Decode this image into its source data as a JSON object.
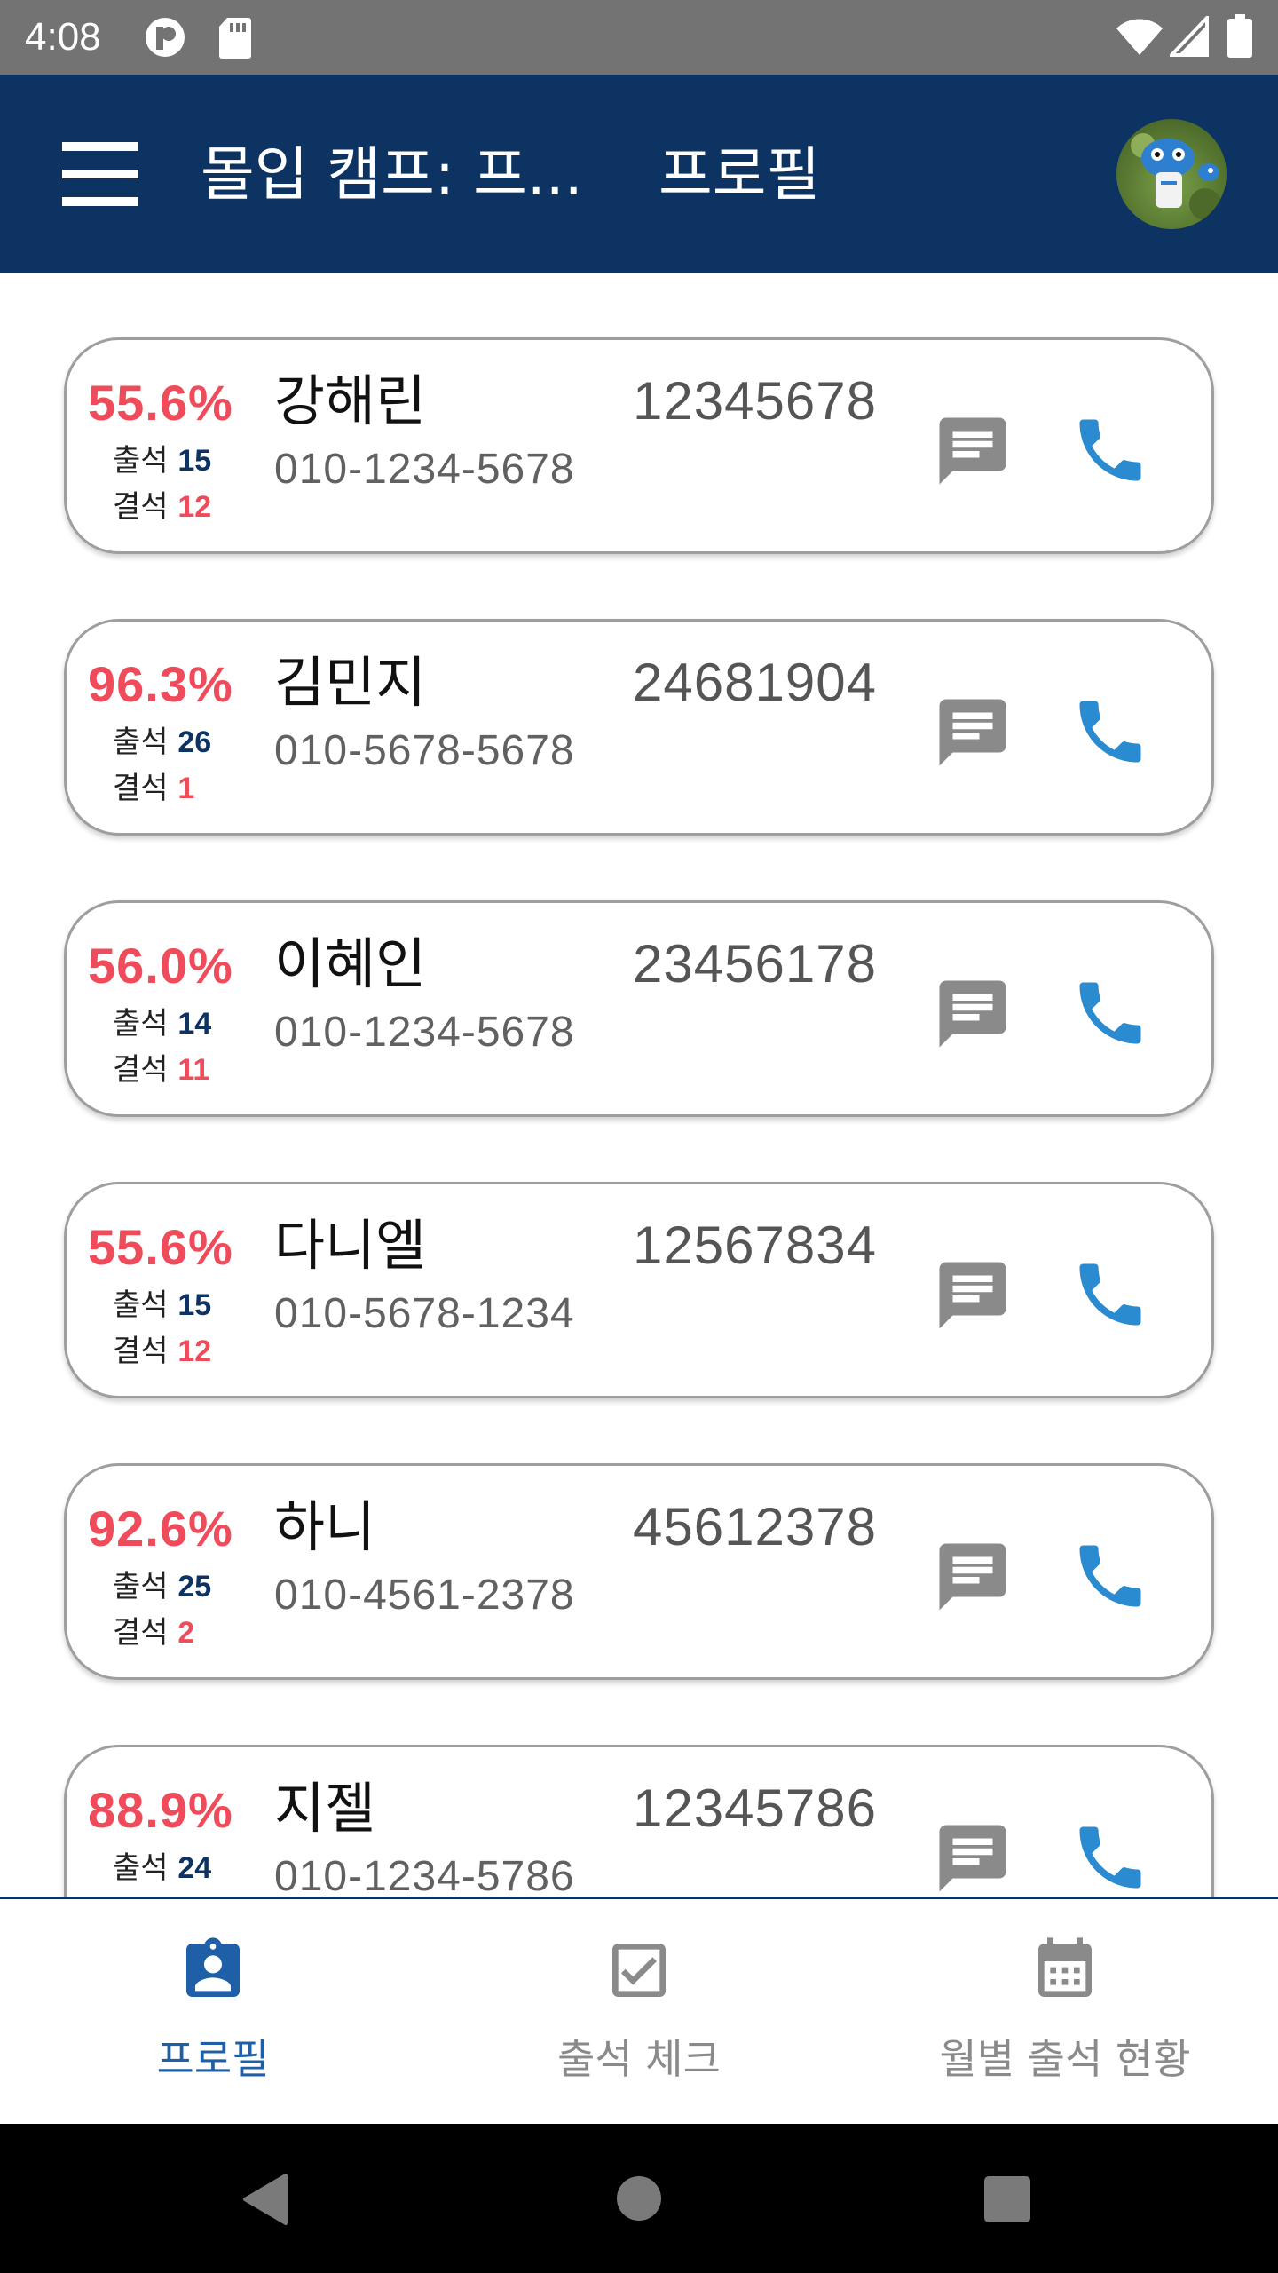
{
  "status_bar": {
    "time": "4:08"
  },
  "app_bar": {
    "title": "몰입 캠프: 프...",
    "subtitle": "프로필"
  },
  "colors": {
    "app_bar": "#0d3363",
    "rate": "#ef4b5b",
    "present_count": "#0d3363",
    "absent_count": "#ef4b5b",
    "call_icon": "#2a8bd0",
    "message_icon": "#8a8a8a",
    "nav_active": "#1f5fa8",
    "nav_inactive": "#8a8a8a"
  },
  "labels": {
    "present": "출석",
    "absent": "결석"
  },
  "students": [
    {
      "rate": "55.6%",
      "name": "강해린",
      "phone": "010-1234-5678",
      "id": "12345678",
      "present": "15",
      "absent": "12"
    },
    {
      "rate": "96.3%",
      "name": "김민지",
      "phone": "010-5678-5678",
      "id": "24681904",
      "present": "26",
      "absent": "1"
    },
    {
      "rate": "56.0%",
      "name": "이혜인",
      "phone": "010-1234-5678",
      "id": "23456178",
      "present": "14",
      "absent": "11"
    },
    {
      "rate": "55.6%",
      "name": "다니엘",
      "phone": "010-5678-1234",
      "id": "12567834",
      "present": "15",
      "absent": "12"
    },
    {
      "rate": "92.6%",
      "name": "하니",
      "phone": "010-4561-2378",
      "id": "45612378",
      "present": "25",
      "absent": "2"
    },
    {
      "rate": "88.9%",
      "name": "지젤",
      "phone": "010-1234-5786",
      "id": "12345786",
      "present": "24"
    }
  ],
  "bottom_nav": {
    "items": [
      {
        "label": "프로필",
        "icon": "profile-badge-icon",
        "active": true
      },
      {
        "label": "출석 체크",
        "icon": "checkbox-icon",
        "active": false
      },
      {
        "label": "월별 출석 현황",
        "icon": "calendar-icon",
        "active": false
      }
    ]
  }
}
